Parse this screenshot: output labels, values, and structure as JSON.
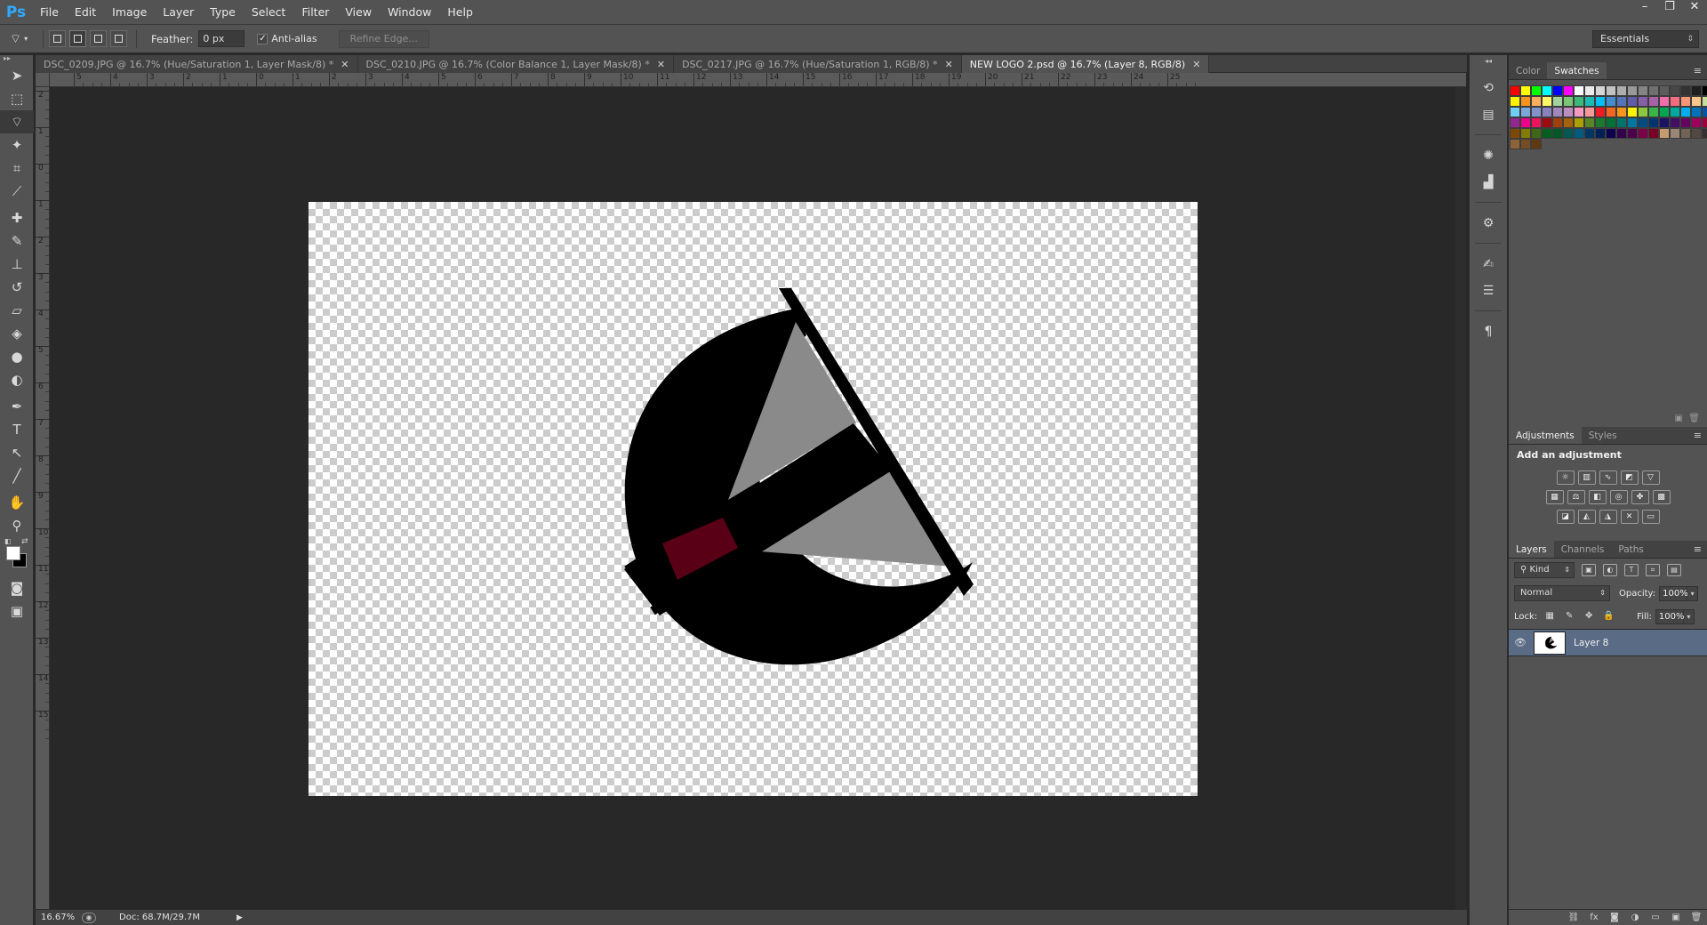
{
  "app": {
    "logo": "Ps"
  },
  "menu": [
    "File",
    "Edit",
    "Image",
    "Layer",
    "Type",
    "Select",
    "Filter",
    "View",
    "Window",
    "Help"
  ],
  "window_controls": {
    "minimize": "–",
    "restore": "❐",
    "close": "✕"
  },
  "options_bar": {
    "feather_label": "Feather:",
    "feather_value": "0 px",
    "antialias_label": "Anti-alias",
    "antialias_checked": true,
    "refine_edge_label": "Refine Edge...",
    "workspace": "Essentials"
  },
  "doc_tabs": [
    {
      "label": "DSC_0209.JPG @ 16.7% (Hue/Saturation 1, Layer Mask/8) *",
      "active": false
    },
    {
      "label": "DSC_0210.JPG @ 16.7% (Color Balance 1, Layer Mask/8) *",
      "active": false
    },
    {
      "label": "DSC_0217.JPG @ 16.7% (Hue/Saturation 1, RGB/8) *",
      "active": false
    },
    {
      "label": "NEW LOGO 2.psd @ 16.7% (Layer 8, RGB/8)",
      "active": true
    }
  ],
  "ruler_h_labels": [
    "5",
    "4",
    "3",
    "2",
    "1",
    "0",
    "1",
    "2",
    "3",
    "4",
    "5",
    "6",
    "7",
    "8",
    "9",
    "10",
    "11",
    "12",
    "13",
    "14",
    "15",
    "16",
    "17",
    "18",
    "19",
    "20",
    "21",
    "22",
    "23",
    "24",
    "25"
  ],
  "ruler_v_labels": [
    "2",
    "1",
    "0",
    "1",
    "2",
    "3",
    "4",
    "5",
    "6",
    "7",
    "8",
    "9",
    "10",
    "11",
    "12",
    "13",
    "14",
    "15"
  ],
  "status": {
    "zoom": "16.67%",
    "doc_size": "Doc: 68.7M/29.7M"
  },
  "color_panel": {
    "tabs": [
      "Color",
      "Swatches"
    ],
    "active_tab": "Swatches"
  },
  "swatch_colors": [
    "#ff0000",
    "#ffff00",
    "#00ff00",
    "#00ffff",
    "#0000ff",
    "#ff00ff",
    "#ffffff",
    "#ebebeb",
    "#d6d6d6",
    "#c2c2c2",
    "#adadad",
    "#999999",
    "#858585",
    "#707070",
    "#5c5c5c",
    "#474747",
    "#333333",
    "#1f1f1f",
    "#000000",
    "#ff8080",
    "#f26c4f",
    "#fff200",
    "#f7941d",
    "#fbaf5d",
    "#fff568",
    "#a3d39c",
    "#7cc576",
    "#3cb878",
    "#1cbbb4",
    "#00bff3",
    "#448ccb",
    "#5674b9",
    "#605ca8",
    "#855fa8",
    "#a763a8",
    "#f06ea9",
    "#f26d7d",
    "#f7977a",
    "#fdc68a",
    "#c4df9b",
    "#82ca9c",
    "#7accc8",
    "#6dcff6",
    "#7da7d9",
    "#8393ca",
    "#8781bd",
    "#a186be",
    "#bc8dbf",
    "#f49ac1",
    "#f5989d",
    "#ed1c24",
    "#f26522",
    "#f7941d",
    "#fff200",
    "#8dc63f",
    "#39b54a",
    "#00a651",
    "#00a99d",
    "#00aeef",
    "#0072bc",
    "#0054a6",
    "#2e3192",
    "#662d91",
    "#92278f",
    "#ec008c",
    "#ed145b",
    "#9e0b0f",
    "#a0410d",
    "#a36209",
    "#aba000",
    "#598527",
    "#1a7b30",
    "#007236",
    "#00746b",
    "#0076a3",
    "#004b80",
    "#003471",
    "#1b1464",
    "#440e62",
    "#630460",
    "#9e005d",
    "#9e0039",
    "#790000",
    "#7b2e00",
    "#7d4900",
    "#827b00",
    "#406618",
    "#005e20",
    "#005826",
    "#005952",
    "#005b7f",
    "#003663",
    "#002157",
    "#0d004c",
    "#32004b",
    "#4b0049",
    "#7b0046",
    "#7a0026",
    "#c69c6e",
    "#998675",
    "#736357",
    "#534741",
    "#362f2d",
    "#c7b299",
    "#a67c52",
    "#8c6239",
    "#754c24",
    "#603913"
  ],
  "adjustments_panel": {
    "tabs": [
      "Adjustments",
      "Styles"
    ],
    "active_tab": "Adjustments",
    "title": "Add an adjustment"
  },
  "layers_panel": {
    "tabs": [
      "Layers",
      "Channels",
      "Paths"
    ],
    "active_tab": "Layers",
    "filter_kind": "Kind",
    "blend_mode": "Normal",
    "opacity_label": "Opacity:",
    "opacity_value": "100%",
    "lock_label": "Lock:",
    "fill_label": "Fill:",
    "fill_value": "100%",
    "layers": [
      {
        "name": "Layer 8",
        "visible": true,
        "selected": true
      }
    ]
  },
  "logo_colors": {
    "crescent": "#000000",
    "sail": "#8a8a8a",
    "accent": "#5a0016"
  }
}
